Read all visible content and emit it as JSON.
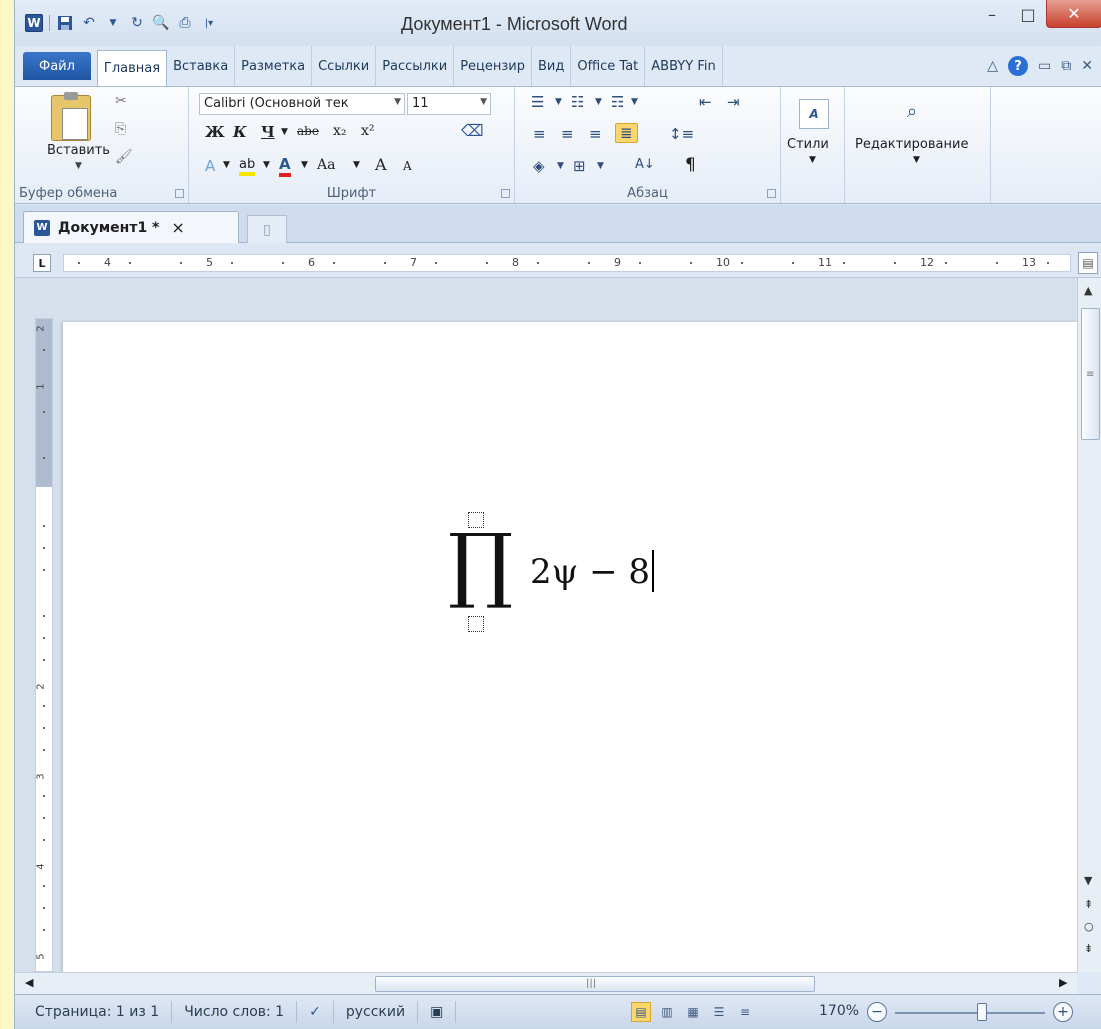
{
  "window": {
    "title": "Документ1 - Microsoft Word",
    "qat_icons": [
      "word-app-icon",
      "save-icon",
      "undo-icon",
      "redo-icon",
      "print-preview-icon",
      "quick-access-icon"
    ],
    "minimize": "–",
    "maximize": "□",
    "close": "✕"
  },
  "ribbon_tabs": [
    "Файл",
    "Главная",
    "Вставка",
    "Разметка",
    "Ссылки",
    "Рассылки",
    "Рецензир",
    "Вид",
    "Office Tat",
    "ABBYY Fin"
  ],
  "clipboard": {
    "paste_label": "Вставить",
    "group_label": "Буфер обмена"
  },
  "font": {
    "font_name": "Calibri (Основной тек",
    "font_size": "11",
    "bold": "Ж",
    "italic": "К",
    "underline": "Ч",
    "strike": "abe",
    "subscript": "x₂",
    "superscript": "x²",
    "change_case": "Aa",
    "grow": "A",
    "shrink": "A",
    "group_label": "Шрифт"
  },
  "paragraph": {
    "pilcrow": "¶",
    "group_label": "Абзац"
  },
  "styles": {
    "label": "Стили"
  },
  "editing": {
    "label": "Редактирование"
  },
  "document_tab": {
    "name": "Документ1 *",
    "close": "×"
  },
  "ruler": {
    "tab_selector": "L",
    "numbers": [
      "4",
      "5",
      "6",
      "7",
      "8",
      "9",
      "10",
      "11",
      "12",
      "13"
    ],
    "vertical_numbers": [
      "2",
      "1",
      "2",
      "3",
      "4",
      "5"
    ]
  },
  "equation": {
    "operator": "∏",
    "expression": "2ψ − 8"
  },
  "statusbar": {
    "page": "Страница: 1 из 1",
    "words": "Число слов: 1",
    "language": "русский",
    "zoom": "170%",
    "zoom_out": "−",
    "zoom_in": "+"
  }
}
